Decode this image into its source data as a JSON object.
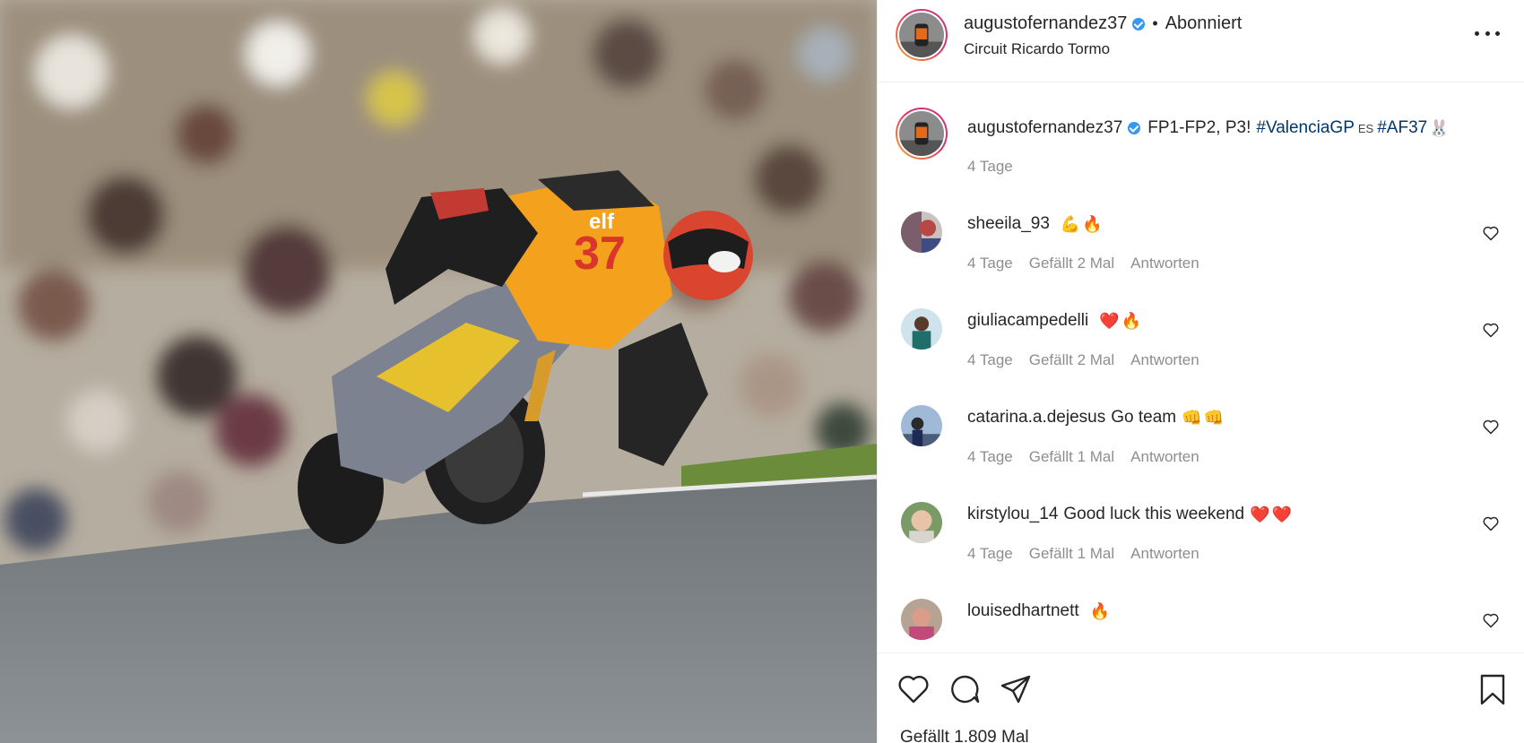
{
  "post": {
    "username": "augustofernandez37",
    "follow_state": "Abonniert",
    "dot": "•",
    "location": "Circuit Ricardo Tormo"
  },
  "caption": {
    "username": "augustofernandez37",
    "text_1": "FP1-FP2, P3!",
    "hashtag_1": "#ValenciaGP",
    "flag": "ES",
    "hashtag_2": "#AF37",
    "rabbit": "🐰",
    "time": "4 Tage"
  },
  "comments": [
    {
      "user": "sheeila_93",
      "text": "",
      "emoji": "💪🔥",
      "time": "4 Tage",
      "likes": "Gefällt 2 Mal",
      "reply": "Antworten"
    },
    {
      "user": "giuliacampedelli",
      "text": "",
      "emoji": "❤️🔥",
      "time": "4 Tage",
      "likes": "Gefällt 2 Mal",
      "reply": "Antworten"
    },
    {
      "user": "catarina.a.dejesus",
      "text": "Go team",
      "emoji": "👊👊",
      "time": "4 Tage",
      "likes": "Gefällt 1 Mal",
      "reply": "Antworten"
    },
    {
      "user": "kirstylou_14",
      "text": "Good luck this weekend",
      "emoji": "❤️❤️",
      "time": "4 Tage",
      "likes": "Gefällt 1 Mal",
      "reply": "Antworten"
    },
    {
      "user": "louisedhartnett",
      "text": "",
      "emoji": "🔥",
      "time": "",
      "likes": "",
      "reply": ""
    }
  ],
  "likes_total": "Gefällt 1.809 Mal",
  "colors": {
    "hashtag": "#00376b",
    "verified": "#3897f0",
    "muted": "#8e8e8e",
    "bike_orange": "#f4a21e"
  },
  "icons": [
    "more-icon",
    "heart-icon",
    "comment-icon",
    "share-icon",
    "bookmark-icon",
    "verified-icon"
  ]
}
